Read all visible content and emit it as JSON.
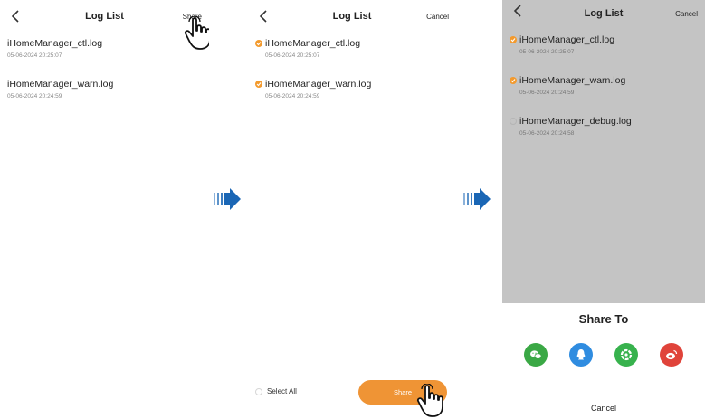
{
  "panel1": {
    "title": "Log List",
    "right_action": "Share",
    "files": [
      {
        "name": "iHomeManager_ctl.log",
        "date": "05-06-2024 20:25:07"
      },
      {
        "name": "iHomeManager_warn.log",
        "date": "05-06-2024 20:24:59"
      }
    ]
  },
  "panel2": {
    "title": "Log List",
    "right_action": "Cancel",
    "files": [
      {
        "name": "iHomeManager_ctl.log",
        "date": "05-06-2024 20:25:07",
        "checked": true
      },
      {
        "name": "iHomeManager_warn.log",
        "date": "05-06-2024 20:24:59",
        "checked": true
      }
    ],
    "select_all_label": "Select All",
    "share_button_label": "Share"
  },
  "panel3": {
    "title": "Log List",
    "right_action": "Cancel",
    "files": [
      {
        "name": "iHomeManager_ctl.log",
        "date": "05-06-2024 20:25:07",
        "checked": true
      },
      {
        "name": "iHomeManager_warn.log",
        "date": "05-06-2024 20:24:59",
        "checked": true
      },
      {
        "name": "iHomeManager_debug.log",
        "date": "05-06-2024 20:24:58",
        "checked": false
      }
    ],
    "share_sheet": {
      "title": "Share To",
      "targets": [
        {
          "icon": "wechat-icon",
          "color": "#3aa845"
        },
        {
          "icon": "qq-icon",
          "color": "#2f8ce0"
        },
        {
          "icon": "moments-icon",
          "color": "#37b24d"
        },
        {
          "icon": "weibo-icon",
          "color": "#e0433a"
        }
      ],
      "cancel_label": "Cancel"
    }
  },
  "colors": {
    "accent": "#ef9435",
    "check": "#f39a2d",
    "arrow": "#1a66b5",
    "dim_overlay": "#c4c4c4"
  }
}
